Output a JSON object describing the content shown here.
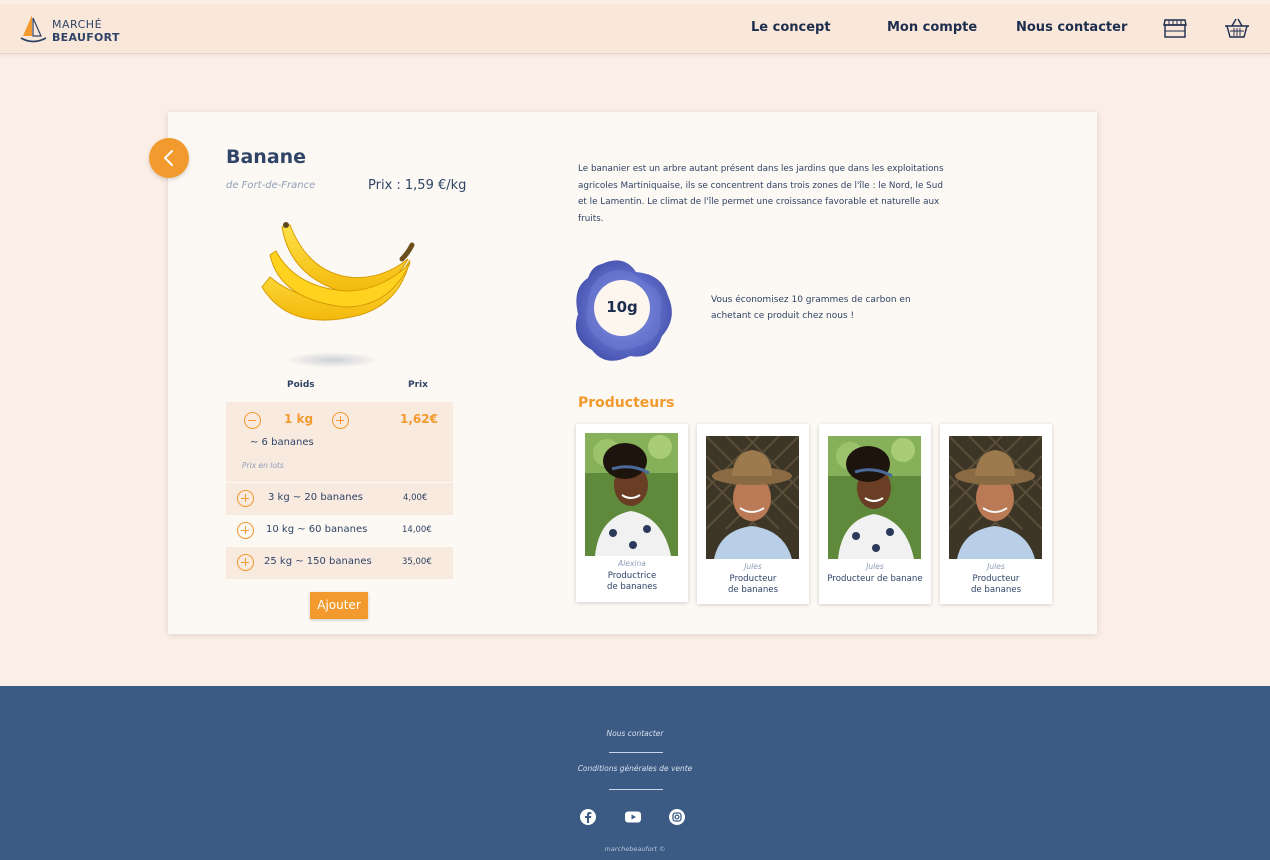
{
  "header": {
    "logo_top": "MARCHÉ",
    "logo_bottom": "BEAUFORT",
    "nav": [
      "Le concept",
      "Mon compte",
      "Nous contacter"
    ],
    "icons": [
      "shop-icon",
      "basket-icon"
    ]
  },
  "product": {
    "name": "Banane",
    "origin": "de Fort-de-France",
    "price": "Prix : 1,59 €/kg",
    "columns": {
      "weight": "Poids",
      "price": "Prix"
    },
    "quantity": {
      "value": "1 kg",
      "price": "1,62€",
      "sub": "~ 6 bananes"
    },
    "lots_label": "Prix en lots",
    "lots": [
      {
        "label": "3 kg ~ 20 bananes",
        "price": "4,00€"
      },
      {
        "label": "10 kg ~ 60 bananes",
        "price": "14,00€"
      },
      {
        "label": "25 kg ~ 150 bananes",
        "price": "35,00€"
      }
    ],
    "add_label": "Ajouter",
    "description": "Le bananier est un arbre autant présent dans les jardins que dans les exploitations agricoles Martiniquaise, ils se concentrent dans trois zones de l'île : le Nord, le Sud et le Lamentin. Le climat de l'île permet une croissance favorable et naturelle aux fruits.",
    "carbon": {
      "value": "10g",
      "text": "Vous économisez 10 grammes de carbon en achetant ce produit chez nous !"
    }
  },
  "producers": {
    "title": "Producteurs",
    "items": [
      {
        "name": "Alexina",
        "role_line1": "Productrice",
        "role_line2": "de bananes"
      },
      {
        "name": "Jules",
        "role_line1": "Producteur",
        "role_line2": "de bananes"
      },
      {
        "name": "Jules",
        "role_line1": "Producteur de banane",
        "role_line2": ""
      },
      {
        "name": "Jules",
        "role_line1": "Producteur",
        "role_line2": "de bananes"
      }
    ]
  },
  "footer": {
    "contact": "Nous contacter",
    "cgv": "Conditions générales de vente",
    "social": [
      "facebook-icon",
      "youtube-icon",
      "instagram-icon"
    ],
    "copyright": "marchebeaufort ©"
  },
  "colors": {
    "accent": "#f29a2e",
    "navy": "#2f4466",
    "footer": "#3b5a84",
    "background": "#fbeee6"
  }
}
